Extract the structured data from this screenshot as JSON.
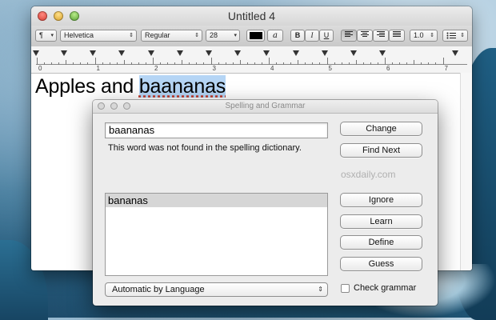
{
  "window": {
    "title": "Untitled 4"
  },
  "toolbar": {
    "paragraph_label": "¶",
    "font_family": "Helvetica",
    "font_style": "Regular",
    "font_size": "28",
    "text_color": "#000000",
    "highlight_glyph": "a",
    "bold_label": "B",
    "italic_label": "I",
    "underline_label": "U",
    "line_spacing": "1.0",
    "list_icon": "list-icon"
  },
  "ruler": {
    "numbers": [
      "0",
      "1",
      "2",
      "3",
      "4",
      "5",
      "6",
      "7"
    ]
  },
  "document": {
    "text_prefix": "Apples and ",
    "misspelled_word": "baananas"
  },
  "spelling_panel": {
    "title": "Spelling and Grammar",
    "word_value": "baananas",
    "message": "This word was not found in the spelling dictionary.",
    "watermark": "osxdaily.com",
    "guesses": [
      "bananas"
    ],
    "language": "Automatic by Language",
    "check_grammar_label": "Check grammar",
    "check_grammar_checked": false,
    "buttons": {
      "change": "Change",
      "find_next": "Find Next",
      "ignore": "Ignore",
      "learn": "Learn",
      "define": "Define",
      "guess": "Guess"
    }
  }
}
